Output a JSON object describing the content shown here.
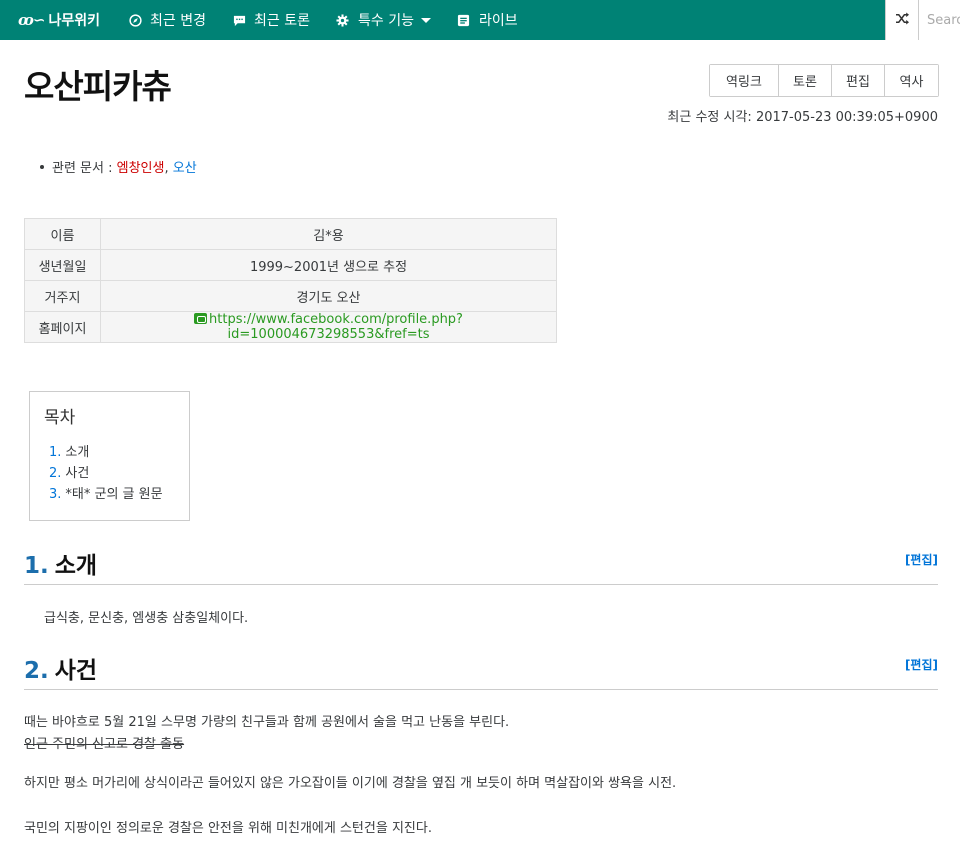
{
  "navbar": {
    "brand": "나무위키",
    "items": [
      {
        "label": "최근 변경",
        "icon": "compass-icon"
      },
      {
        "label": "최근 토론",
        "icon": "comment-icon"
      },
      {
        "label": "특수 기능",
        "icon": "gear-icon"
      },
      {
        "label": "라이브",
        "icon": "list-icon"
      }
    ],
    "search_placeholder": "Search"
  },
  "page": {
    "title": "오산피카츄",
    "tools": [
      "역링크",
      "토론",
      "편집",
      "역사"
    ],
    "edit_time": "최근 수정 시각: 2017-05-23 00:39:05+0900"
  },
  "related": {
    "label": "관련 문서 : ",
    "links": [
      "엠창인생",
      "오산"
    ],
    "separator": ", "
  },
  "info_table": [
    {
      "key": "이름",
      "value": "김*용"
    },
    {
      "key": "생년월일",
      "value": "1999~2001년 생으로 추정"
    },
    {
      "key": "거주지",
      "value": "경기도 오산"
    },
    {
      "key": "홈페이지",
      "value": "https://www.facebook.com/profile.php?id=100004673298553&fref=ts"
    }
  ],
  "toc": {
    "title": "목차",
    "items": [
      {
        "num": "1.",
        "label": "소개"
      },
      {
        "num": "2.",
        "label": "사건"
      },
      {
        "num": "3.",
        "label": "*태* 군의 글 원문"
      }
    ]
  },
  "sections": [
    {
      "num": "1.",
      "title": "소개",
      "edit": "[편집]"
    },
    {
      "num": "2.",
      "title": "사건",
      "edit": "[편집]"
    }
  ],
  "content": {
    "intro": "급식충, 문신충, 엠생충 삼충일체이다.",
    "p1": "때는 바야흐로 5월 21일 스무명 가량의 친구들과 함께 공원에서 술을 먹고 난동을 부린다.",
    "p1_strike": "인근 주민의 신고로 경찰 출동",
    "p2": "하지만 평소 머가리에 상식이라곤 들어있지 않은 가오잡이들 이기에 경찰을 옆집 개 보듯이 하며 멱살잡이와 쌍욕을 시전.",
    "p3": "국민의 지팡이인 정의로운 경찰은 안전을 위해 미친개에게 스턴건을 지진다."
  }
}
